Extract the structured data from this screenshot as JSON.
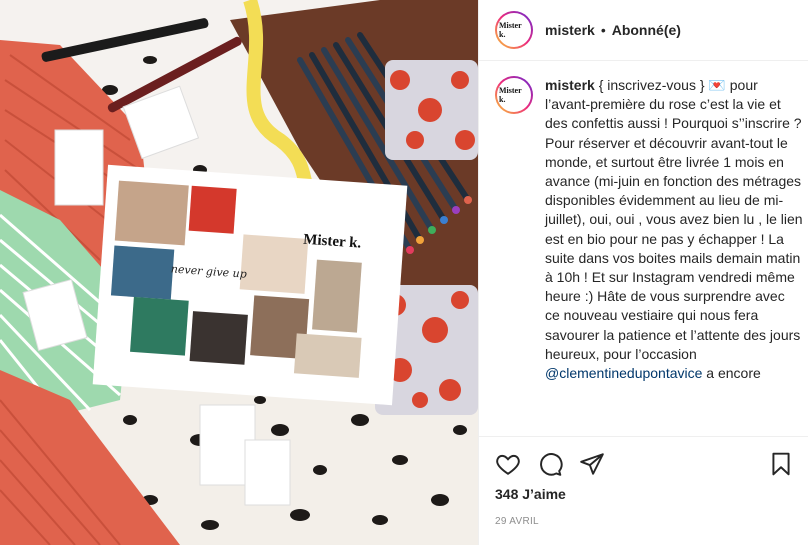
{
  "header": {
    "username": "misterk",
    "separator": "•",
    "follow_status": "Abonné(e)",
    "avatar_text": "Mister k."
  },
  "caption": {
    "username": "misterk",
    "avatar_text": "Mister k.",
    "text_part1": "{ inscrivez-vous } ",
    "heart_emoji": "💌",
    "text_part2": " pour l’avant-première du rose c’est la vie et des confettis aussi ! Pourquoi s’’inscrire ? Pour réserver et découvrir avant-tout le monde, et surtout être livrée 1 mois en avance (mi-juin en fonction des métrages disponibles évidemment au lieu de mi-juillet), oui, oui , vous avez bien lu , le lien est en bio pour ne pas y échapper ! La suite dans vos boites mails demain matin à 10h ! Et sur Instagram vendredi même heure :) Hâte de vous surprendre avec ce nouveau vestiaire qui nous fera savourer la patience et l’attente des jours heureux, pour l’occasion ",
    "mention": "@clementinedupontavice",
    "text_part3": " a encore"
  },
  "photo": {
    "moodboard_title": "Mister k.",
    "moodboard_phrase": "never give up"
  },
  "actions": {
    "like_icon": "heart-outline-icon",
    "comment_icon": "comment-bubble-icon",
    "share_icon": "paper-plane-icon",
    "save_icon": "bookmark-icon"
  },
  "likes": "348 J’aime",
  "date": "29 AVRIL"
}
